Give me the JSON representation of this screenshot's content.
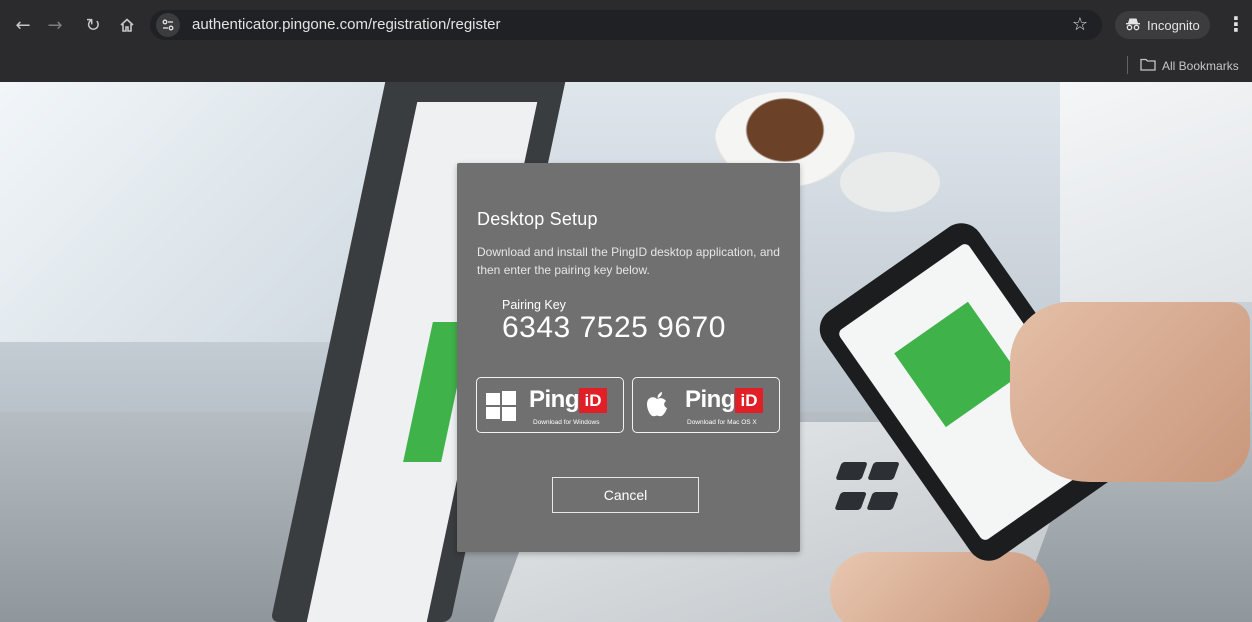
{
  "browser": {
    "url": "authenticator.pingone.com/registration/register",
    "incognito_label": "Incognito",
    "all_bookmarks_label": "All Bookmarks",
    "icons": [
      "back-arrow-icon",
      "forward-arrow-icon",
      "reload-icon",
      "home-icon",
      "site-info-icon",
      "bookmark-star-icon",
      "incognito-icon",
      "more-menu-icon",
      "folder-icon"
    ]
  },
  "dialog": {
    "title": "Desktop Setup",
    "description": "Download and install the PingID desktop application, and then enter the pairing key below.",
    "pairing_key_label": "Pairing Key",
    "pairing_key": "6343 7525 9670",
    "download_windows": {
      "brand": "Ping",
      "badge": "iD",
      "caption": "Download for Windows",
      "icon": "windows-logo-icon"
    },
    "download_mac": {
      "brand": "Ping",
      "badge": "iD",
      "caption": "Download for Mac OS X",
      "icon": "apple-logo-icon"
    },
    "cancel_label": "Cancel"
  },
  "colors": {
    "dialog_bg": "#707070",
    "brand_red": "#e01f26",
    "chrome_bg": "#2b2b2d"
  }
}
